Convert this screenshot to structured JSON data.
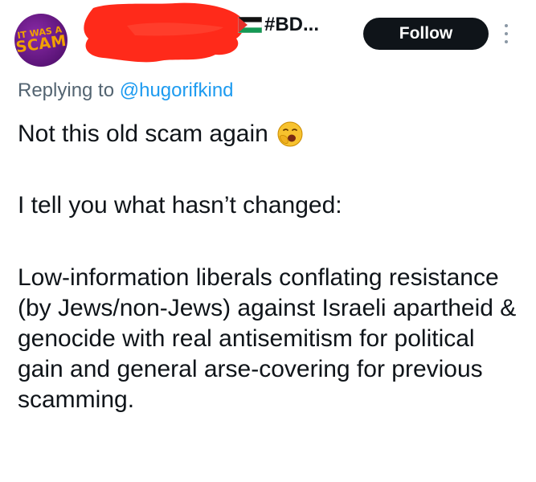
{
  "author": {
    "avatar_text_line1": "IT WAS A",
    "avatar_text_line2": "SCAM",
    "display_name_redacted": true,
    "handle": "#BD...",
    "flag_icon": "palestine-flag-icon"
  },
  "follow_button": {
    "label": "Follow"
  },
  "more_menu": {
    "icon": "more-vertical-icon"
  },
  "reply_context": {
    "prefix": "Replying to",
    "mention": "@hugorifkind"
  },
  "tweet": {
    "line1": "Not this old scam again",
    "line1_emoji": "yawning-face-emoji",
    "line2": "I tell you what hasn’t changed:",
    "line3": "Low-information liberals conflating resistance (by Jews/non-Jews) against Israeli apartheid & genocide with real antisemitism for political gain and general arse-covering for previous scamming."
  },
  "colors": {
    "text": "#0f1419",
    "muted": "#536471",
    "link": "#1d9bf0",
    "button_bg": "#0f1419",
    "redaction": "#ff2a1a",
    "avatar_bg": "#5b1478",
    "avatar_text": "#f0a100"
  }
}
